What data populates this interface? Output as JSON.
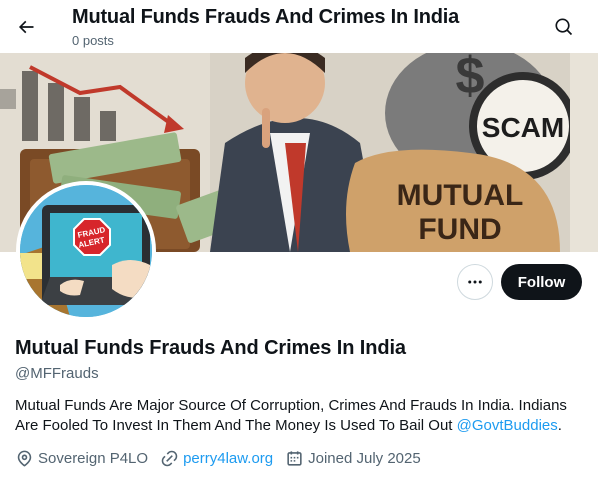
{
  "header": {
    "title": "Mutual Funds Frauds And Crimes In India",
    "post_count": "0 posts"
  },
  "banner": {
    "scam_label": "SCAM",
    "bag_label_1": "MUTUAL",
    "bag_label_2": "FUND",
    "dollar_sign": "$"
  },
  "avatar": {
    "sign_line_1": "FRAUD",
    "sign_line_2": "ALERT"
  },
  "actions": {
    "follow_label": "Follow"
  },
  "profile": {
    "name": "Mutual Funds Frauds And Crimes In India",
    "handle": "@MFFrauds",
    "bio_text": "Mutual Funds Are Major Source Of Corruption, Crimes And Frauds In India. Indians Are Fooled To Invest In Them And The Money Is Used To Bail Out ",
    "bio_mention": "@GovtBuddies",
    "bio_end": ".",
    "location": "Sovereign P4LO",
    "website": "perry4law.org",
    "joined": "Joined July 2025"
  },
  "icons": {
    "back": "arrow-left-icon",
    "search": "search-icon",
    "more": "more-horizontal-icon",
    "location": "location-pin-icon",
    "link": "link-icon",
    "calendar": "calendar-icon"
  },
  "colors": {
    "text_primary": "#0f1419",
    "text_secondary": "#536471",
    "link": "#1d9bf0",
    "follow_bg": "#0f1419"
  }
}
